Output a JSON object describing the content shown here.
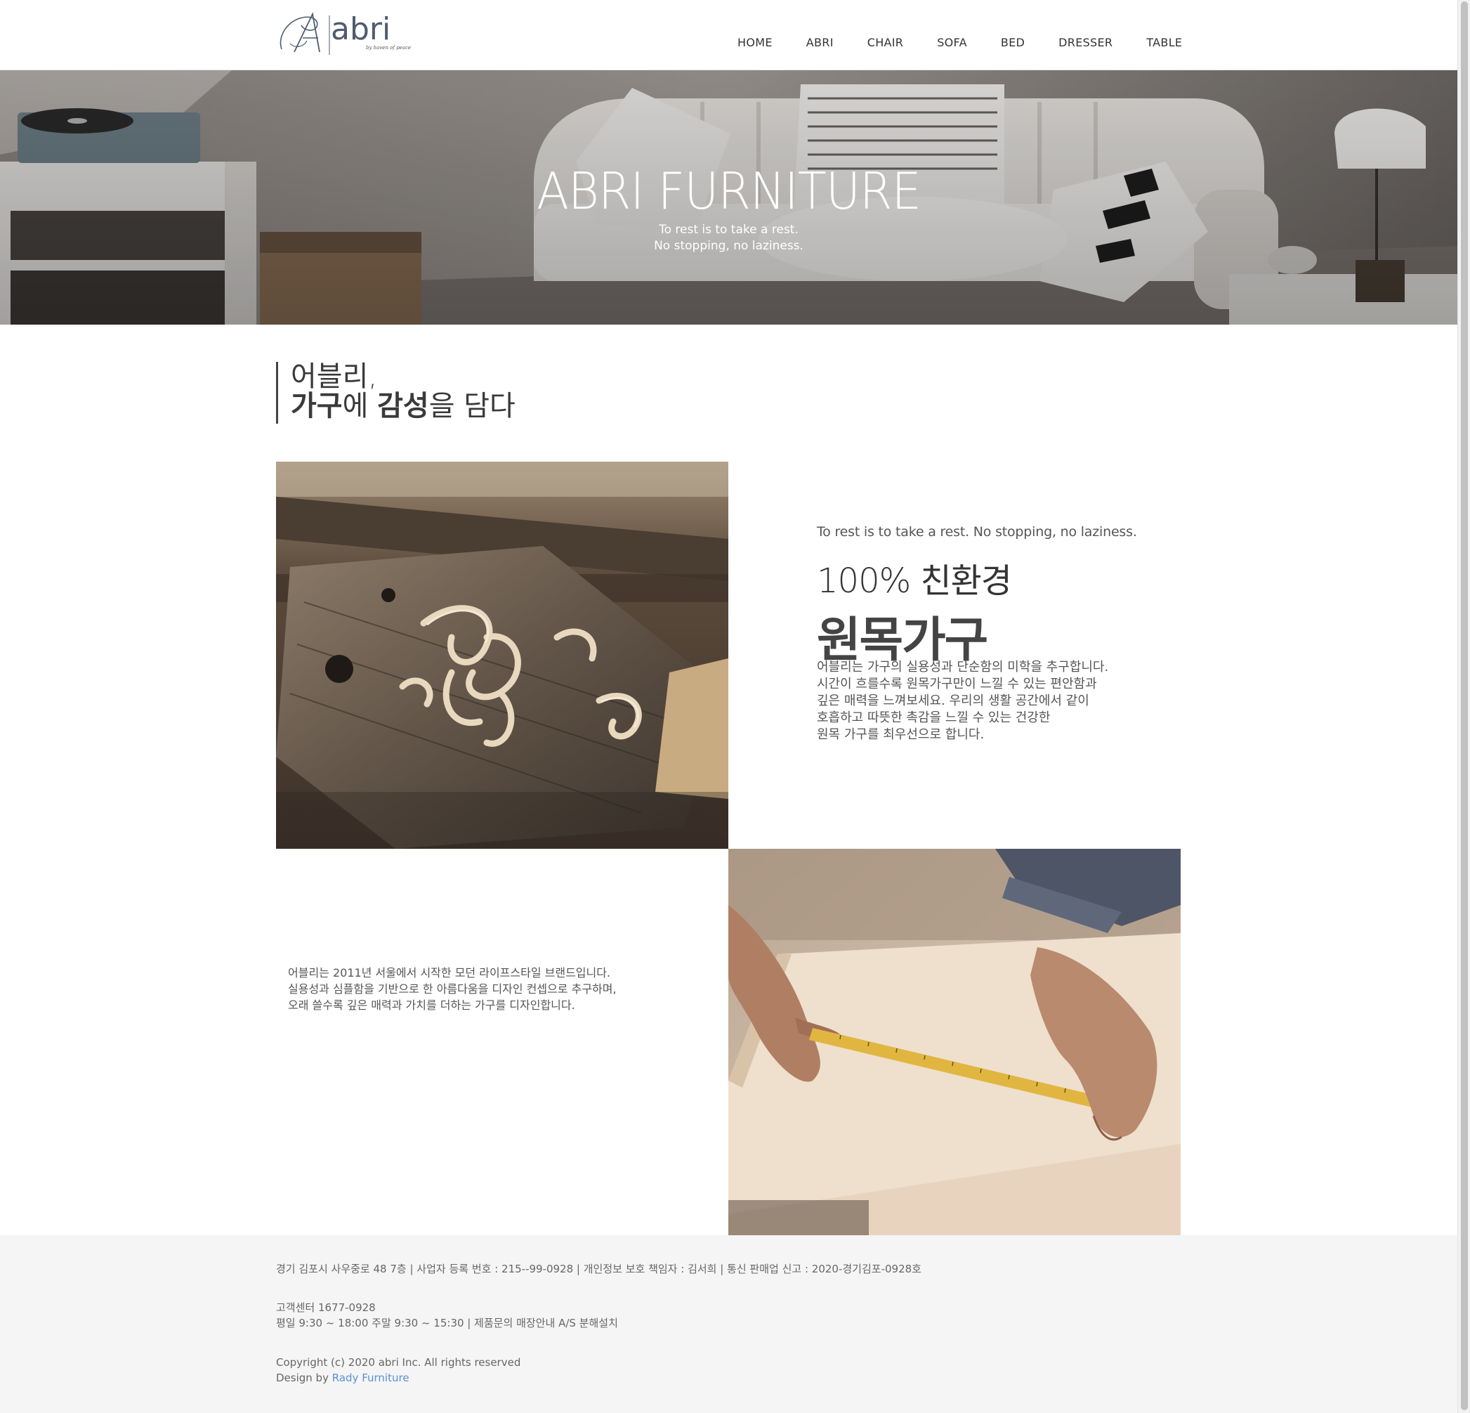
{
  "header": {
    "logo_text": "abri",
    "logo_tagline": "by haven of peace",
    "nav": [
      "HOME",
      "ABRI",
      "CHAIR",
      "SOFA",
      "BED",
      "DRESSER",
      "TABLE"
    ]
  },
  "hero": {
    "title": "ABRI FURNITURE",
    "subtitle_line1": "To rest is to take a rest.",
    "subtitle_line2": "No stopping, no laziness."
  },
  "intro": {
    "line1": "어블리,",
    "line2_bold1": "가구",
    "line2_part1": "에 ",
    "line2_bold2": "감성",
    "line2_part2": "을 담다"
  },
  "feature": {
    "tagline": "To rest is to take a rest. No stopping, no laziness.",
    "eco": "100% 친환경",
    "solid": "원목가구",
    "desc": [
      "어블리는 가구의 실용성과 단순함의 미학을 추구합니다.",
      "시간이 흐를수록 원목가구만이 느낄 수 있는 편안함과",
      "깊은 매력을 느껴보세요. 우리의 생활 공간에서 같이",
      "호흡하고 따뜻한 촉감을 느낄 수 있는 건강한",
      "원목 가구를 최우선으로 합니다."
    ]
  },
  "story": [
    "어블리는 2011년 서울에서 시작한 모던 라이프스타일 브랜드입니다.",
    "실용성과 심플함을 기반으로 한 아름다움을 디자인 컨셉으로 추구하며,",
    "오래 쓸수록 깊은 매력과 가치를 더하는 가구를 디자인합니다."
  ],
  "footer": {
    "address": "경기 김포시 사우중로 48 7층 | 사업자 등록 번호 : 215--99-0928 | 개인정보 보호 책임자 : 김서희 | 통신 판매업 신고 : 2020-경기김포-0928호",
    "cs_phone": "고객센터 1677-0928",
    "hours": "평일 9:30 ~ 18:00 주말 9:30 ~ 15:30 | 제품문의 매장안내 A/S 분해설치",
    "copyright": "Copyright (c) 2020 abri Inc. All rights reserved",
    "design_by": "Design by",
    "designer": "Rady Furniture"
  }
}
